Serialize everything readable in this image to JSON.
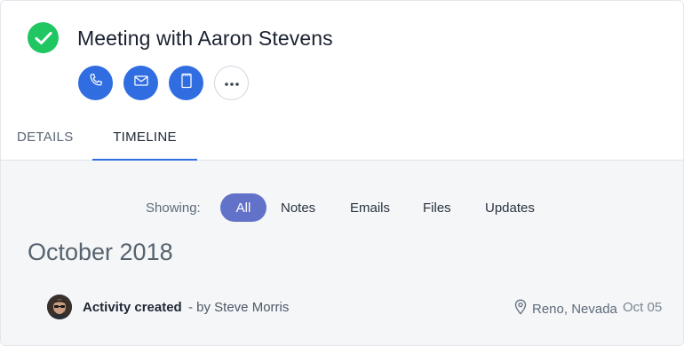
{
  "colors": {
    "accent": "#2f6de1",
    "success": "#1fc662",
    "filter_active": "#6272c9",
    "timeline_bg": "#f4f6f8"
  },
  "header": {
    "status_icon": "check-icon",
    "title": "Meeting with Aaron Stevens",
    "actions": [
      {
        "name": "call",
        "icon": "phone-icon"
      },
      {
        "name": "email",
        "icon": "envelope-icon"
      },
      {
        "name": "note",
        "icon": "notepad-icon"
      },
      {
        "name": "more",
        "icon": "ellipsis-icon"
      }
    ]
  },
  "tabs": [
    {
      "label": "DETAILS",
      "active": false
    },
    {
      "label": "TIMELINE",
      "active": true
    }
  ],
  "filters": {
    "label": "Showing:",
    "options": [
      "All",
      "Notes",
      "Emails",
      "Files",
      "Updates"
    ],
    "selected": "All"
  },
  "timeline": {
    "month": "October 2018",
    "entries": [
      {
        "avatar": "avatar-steve-morris",
        "title": "Activity created",
        "by": "- by Steve Morris",
        "location_icon": "map-pin-icon",
        "location": "Reno, Nevada",
        "date": "Oct 05"
      }
    ]
  }
}
